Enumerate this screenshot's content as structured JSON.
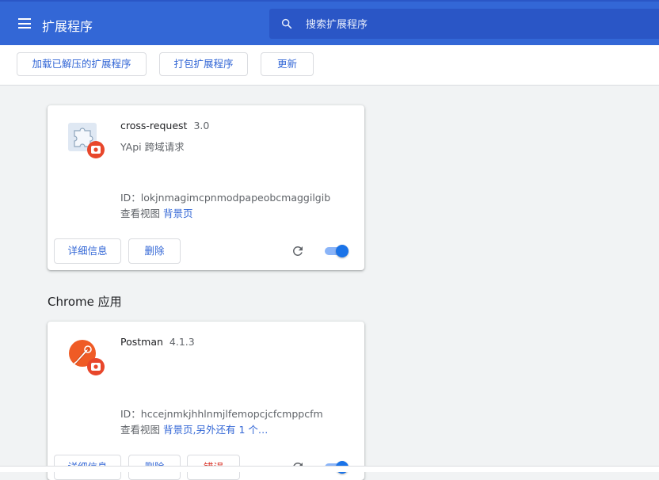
{
  "header": {
    "title": "扩展程序",
    "menu_icon": "hamburger-menu-icon",
    "search_placeholder": "搜索扩展程序",
    "search_icon": "search-icon",
    "bg_color": "#3367d6"
  },
  "toolbar": {
    "load_unpacked": "加载已解压的扩展程序",
    "pack": "打包扩展程序",
    "update": "更新"
  },
  "extensions": [
    {
      "name": "cross-request",
      "version": "3.0",
      "description": "YApi 跨域请求",
      "id_text": "ID：lokjnmagimcpnmodpapeobcmaggilgib",
      "views_label": "查看视图",
      "views_link": "背景页",
      "details_label": "详细信息",
      "remove_label": "删除",
      "enabled": true,
      "icon": "puzzle-piece-icon"
    }
  ],
  "apps_section": {
    "title": "Chrome 应用",
    "apps": [
      {
        "name": "Postman",
        "version": "4.1.3",
        "id_text": "ID：hccejnmkjhhlnmjlfemopcjcfcmppcfm",
        "views_label": "查看视图",
        "views_link": "背景页,另外还有 1 个…",
        "details_label": "详细信息",
        "remove_label": "删除",
        "errors_label": "错误",
        "enabled": true,
        "icon": "postman-icon"
      }
    ]
  },
  "colors": {
    "accent": "#3367d6",
    "toggle_on": "#1a73e8",
    "error": "#d93025",
    "badge": "#e8472b"
  }
}
